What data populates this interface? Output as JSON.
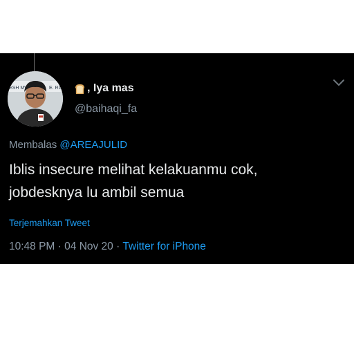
{
  "tweet": {
    "display_name": ", Iya mas",
    "handle": "@baihaqi_fa",
    "reply_prefix": "Membalas ",
    "reply_mention": "@AREAJULID",
    "text_line1": "Iblis insecure melihat kelakuanmu cok,",
    "text_line2": "jobdesknya lu ambil semua",
    "translate_label": "Terjemahkan Tweet",
    "time": "10:48 PM",
    "separator": " · ",
    "date": "04 Nov 20",
    "source": "Twitter for iPhone"
  },
  "icons": {
    "name_emoji": "bread-icon",
    "more": "chevron-down-icon"
  },
  "colors": {
    "card_background": "#000000",
    "page_background": "#ffffff",
    "primary_text": "#e7e9ea",
    "secondary_text": "#8b98a5",
    "link": "#1d9bf0"
  }
}
